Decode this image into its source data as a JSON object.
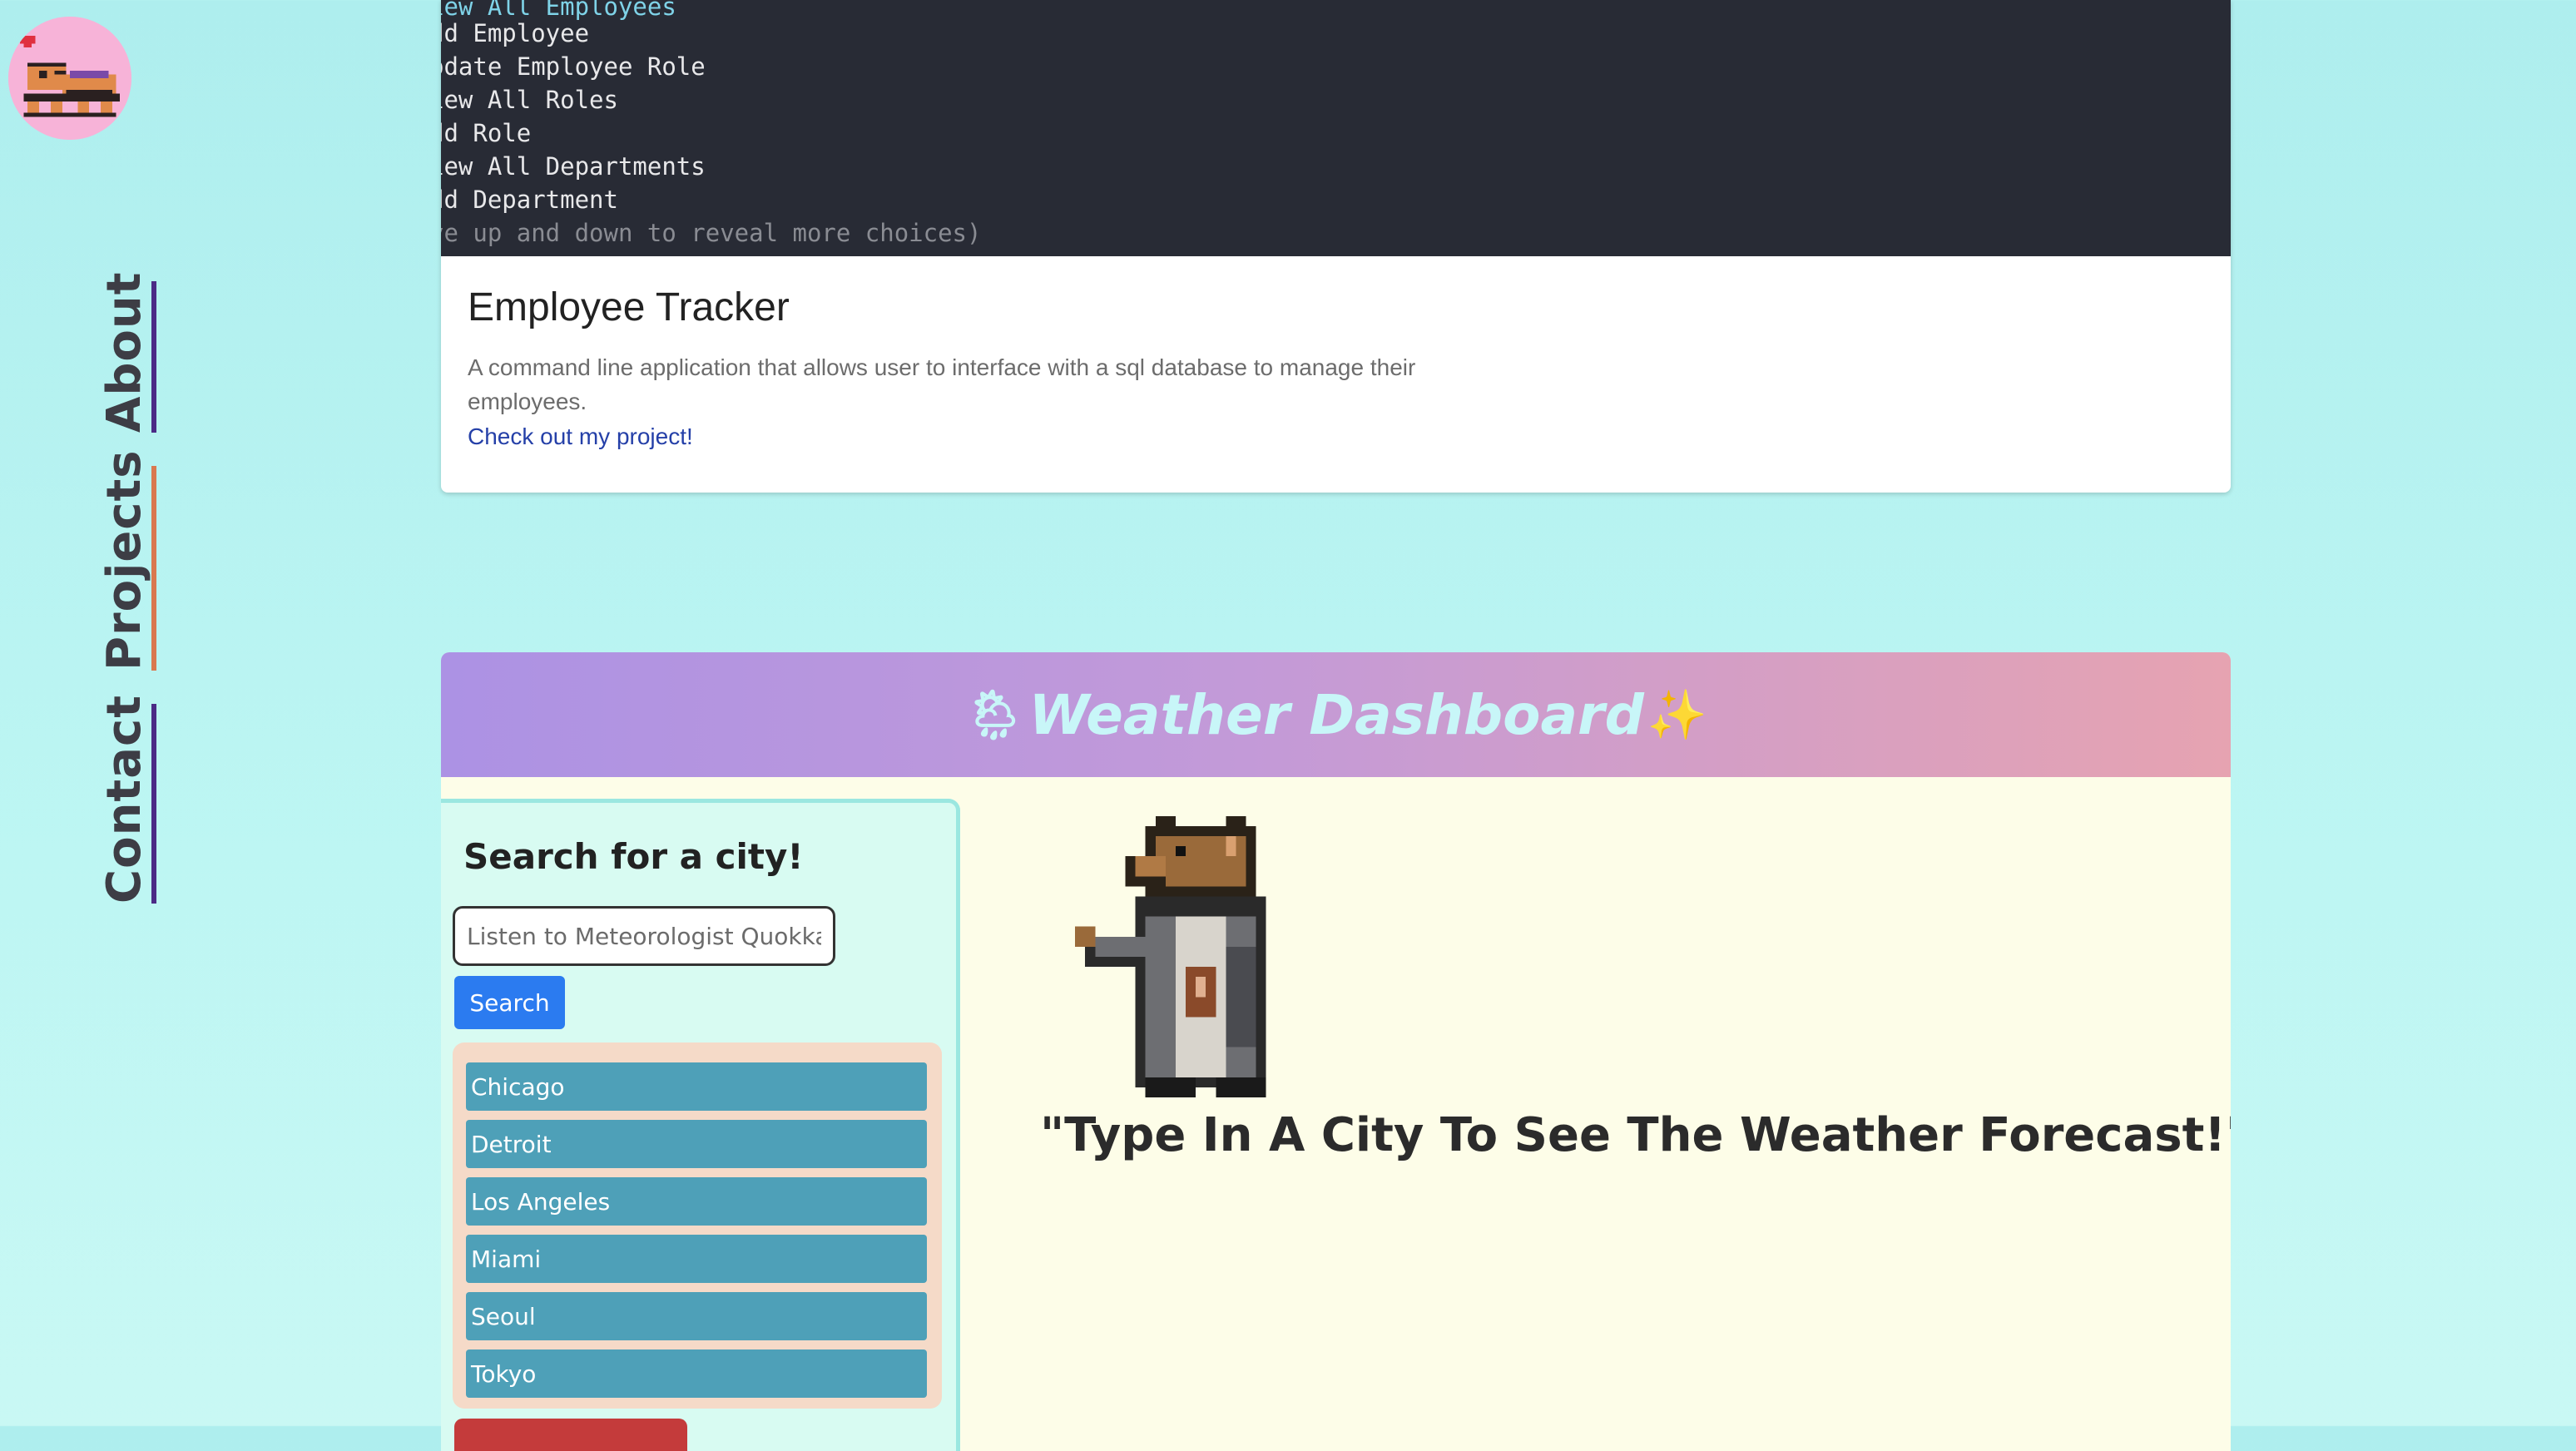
{
  "nav": {
    "items": [
      {
        "label": "About"
      },
      {
        "label": "Projects"
      },
      {
        "label": "Contact"
      }
    ]
  },
  "employee_tracker": {
    "terminal_lines": [
      "iew All Employees",
      "dd Employee",
      "pdate Employee Role",
      "iew All Roles",
      "dd Role",
      "iew All Departments",
      "dd Department",
      "ve up and down to reveal more choices)"
    ],
    "title": "Employee Tracker",
    "description": "A command line application that allows user to interface with a sql database to manage their employees.",
    "link_label": "Check out my project!"
  },
  "weather": {
    "title_emoji_left": "🌦",
    "title": "Weather Dashboard",
    "title_emoji_right": "✨",
    "search_heading": "Search for a city!",
    "search_placeholder": "Listen to Meteorologist Quokka!",
    "search_button": "Search",
    "history": [
      "Chicago",
      "Detroit",
      "Los Angeles",
      "Miami",
      "Seoul",
      "Tokyo"
    ],
    "prompt": "\"Type In A City To See The Weather Forecast!\""
  },
  "colors": {
    "page_bg": "#bdf6f3",
    "terminal_bg": "#282b35",
    "header_gradient_start": "#ac92e4",
    "header_gradient_end": "#e6a3b1",
    "city_button": "#4ea0b8",
    "search_button": "#2b7bf0",
    "clear_button": "#c43b3b"
  }
}
